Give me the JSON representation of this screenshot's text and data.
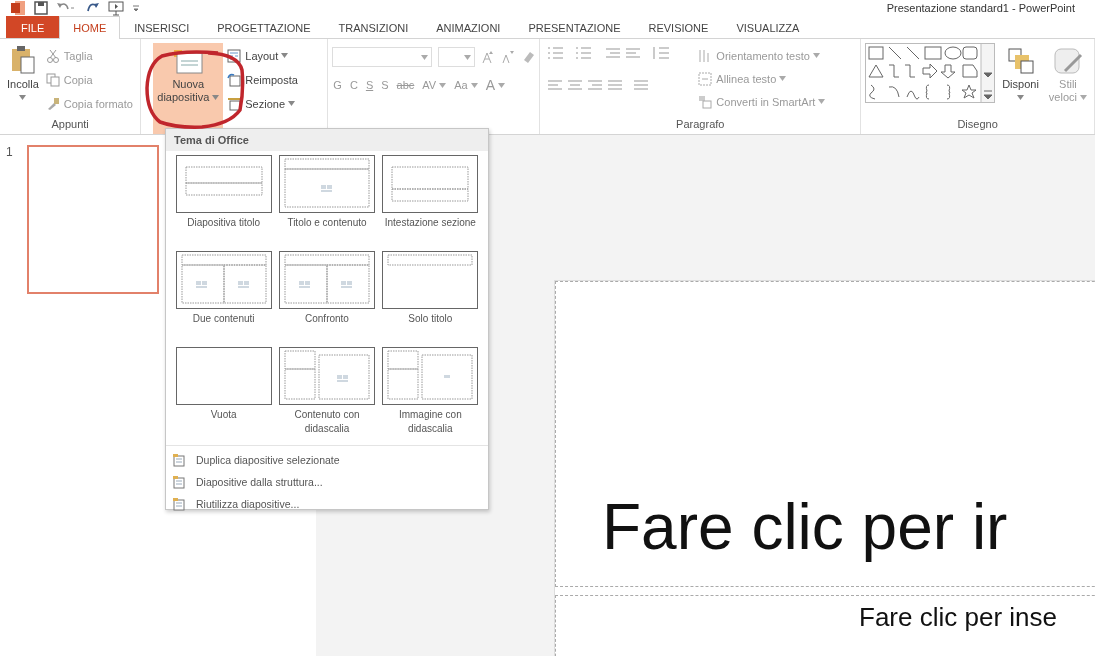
{
  "window": {
    "title": "Presentazione standard1 - PowerPoint"
  },
  "tabs": [
    {
      "label": "FILE",
      "kind": "file",
      "selected": false
    },
    {
      "label": "HOME",
      "kind": "tab",
      "selected": true
    },
    {
      "label": "INSERISCI",
      "kind": "tab",
      "selected": false
    },
    {
      "label": "PROGETTAZIONE",
      "kind": "tab",
      "selected": false
    },
    {
      "label": "TRANSIZIONI",
      "kind": "tab",
      "selected": false
    },
    {
      "label": "ANIMAZIONI",
      "kind": "tab",
      "selected": false
    },
    {
      "label": "PRESENTAZIONE",
      "kind": "tab",
      "selected": false
    },
    {
      "label": "REVISIONE",
      "kind": "tab",
      "selected": false
    },
    {
      "label": "VISUALIZZA",
      "kind": "tab",
      "selected": false
    }
  ],
  "clipboard": {
    "paste": "Incolla",
    "cut": "Taglia",
    "copy": "Copia",
    "format_painter": "Copia formato",
    "label": "Appunti"
  },
  "slides": {
    "new_slide": "Nuova",
    "new_slide_2": "diapositiva",
    "pressed": true,
    "layout": "Layout",
    "reset": "Reimposta",
    "section": "Sezione"
  },
  "font": {
    "bold": "G",
    "italic": "C",
    "underline": "S",
    "shadow": "S",
    "strike": "abc",
    "spacing": "AV",
    "case": "Aa",
    "font_colour_button": "A"
  },
  "paragraph": {
    "text_direction": "Orientamento testo",
    "align_text": "Allinea testo",
    "smartart": "Converti in SmartArt",
    "label": "Paragrafo"
  },
  "drawing": {
    "arrange": "Disponi",
    "quick_styles": "Stili",
    "quick_styles_2": "veloci",
    "label": "Disegno"
  },
  "menu": {
    "header": "Tema di Office",
    "layouts": [
      {
        "label": "Diapositiva titolo",
        "kind": "title"
      },
      {
        "label": "Titolo e contenuto",
        "kind": "title-content"
      },
      {
        "label": "Intestazione sezione",
        "kind": "section"
      },
      {
        "label": "Due contenuti",
        "kind": "two-content"
      },
      {
        "label": "Confronto",
        "kind": "comparison"
      },
      {
        "label": "Solo titolo",
        "kind": "title-only"
      },
      {
        "label": "Vuota",
        "kind": "blank"
      },
      {
        "label": "Contenuto con didascalia",
        "kind": "content-caption"
      },
      {
        "label": "Immagine con didascalia",
        "kind": "picture-caption"
      }
    ],
    "actions": [
      "Duplica diapositive selezionate",
      "Diapositive dalla struttura...",
      "Riutilizza diapositive..."
    ]
  },
  "thumbnails": [
    {
      "number": "1",
      "selected": true
    }
  ],
  "slide": {
    "title": "Fare clic per ir",
    "subtitle": "Fare clic per inse"
  }
}
